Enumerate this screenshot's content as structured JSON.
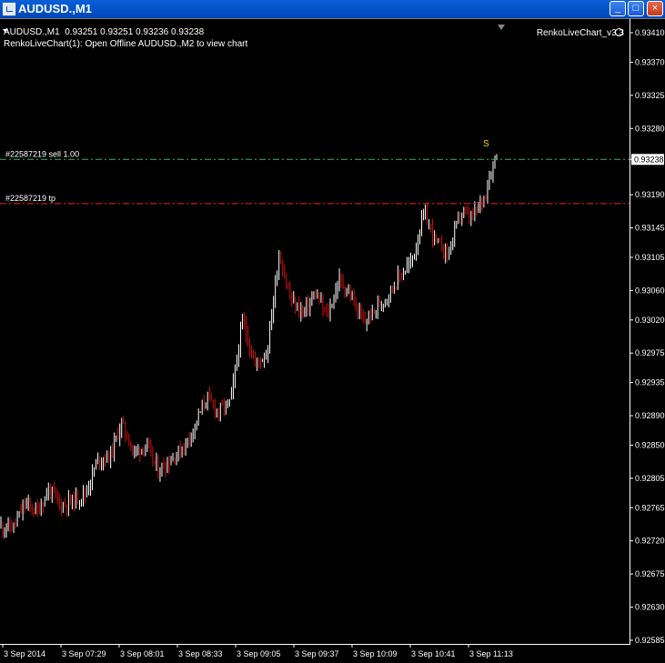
{
  "window": {
    "title": "AUDUSD.,M1",
    "min_label": "_",
    "max_label": "□",
    "close_label": "×"
  },
  "info": {
    "symbol_line": "AUDUSD.,M1  0.93251 0.93251 0.93236 0.93238",
    "message": "RenkoLiveChart(1): Open Offline AUDUSD.,M2 to view chart"
  },
  "expert": {
    "label": "RenkoLiveChart_v3.3",
    "icon": "smiley-icon"
  },
  "orders": {
    "sell_label": "#22587219 sell 1.00",
    "tp_label": "#22587219 tp",
    "sell_price": 0.93238,
    "tp_price": 0.93178,
    "sell_color": "#3cb371",
    "tp_color": "#ff2020"
  },
  "signal": {
    "label": "S",
    "color": "#ffd700"
  },
  "colors": {
    "bull": "#ffffff",
    "bear": "#d21010",
    "axis": "#ffffff"
  },
  "chart_data": {
    "type": "bar",
    "price_labels": [
      "0.93410",
      "0.93370",
      "0.93325",
      "0.93280",
      "0.93238",
      "0.93190",
      "0.93145",
      "0.93105",
      "0.93060",
      "0.93020",
      "0.92975",
      "0.92935",
      "0.92890",
      "0.92850",
      "0.92805",
      "0.92765",
      "0.92720",
      "0.92675",
      "0.92630",
      "0.92585"
    ],
    "price_values": [
      0.9341,
      0.9337,
      0.93325,
      0.9328,
      0.93238,
      0.9319,
      0.93145,
      0.93105,
      0.9306,
      0.9302,
      0.92975,
      0.92935,
      0.9289,
      0.9285,
      0.92805,
      0.92765,
      0.9272,
      0.92675,
      0.9263,
      0.92585
    ],
    "current_price": "0.93238",
    "time_labels": [
      "3 Sep 2014",
      "3 Sep 07:29",
      "3 Sep 08:01",
      "3 Sep 08:33",
      "3 Sep 09:05",
      "3 Sep 09:37",
      "3 Sep 10:09",
      "3 Sep 10:41",
      "3 Sep 11:13"
    ],
    "ylim": [
      0.92585,
      0.9341
    ],
    "close_path": [
      0.9274,
      0.92738,
      0.9277,
      0.9276,
      0.9279,
      0.92768,
      0.92775,
      0.92785,
      0.9283,
      0.92835,
      0.9288,
      0.9284,
      0.9285,
      0.92815,
      0.9283,
      0.92845,
      0.92875,
      0.92915,
      0.92895,
      0.9291,
      0.9302,
      0.9296,
      0.92975,
      0.9311,
      0.93045,
      0.9303,
      0.93055,
      0.93025,
      0.93075,
      0.9305,
      0.93015,
      0.93035,
      0.93055,
      0.9308,
      0.931,
      0.93165,
      0.93125,
      0.9311,
      0.93165,
      0.93158,
      0.9319,
      0.9325
    ]
  }
}
